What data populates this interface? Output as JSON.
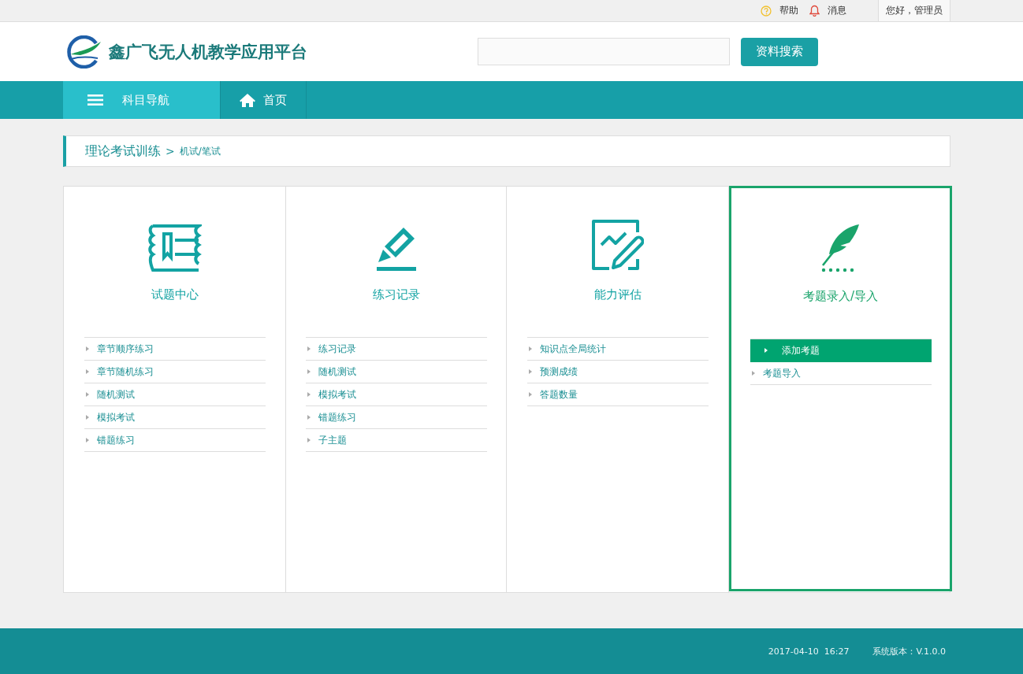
{
  "topbar": {
    "help": "帮助",
    "messages": "消息",
    "user": "您好，管理员"
  },
  "header": {
    "logo_text": "鑫广飞无人机教学应用平台",
    "search_button": "资料搜索"
  },
  "nav": [
    {
      "label": "科目导航",
      "kind": "menu",
      "selected": true
    },
    {
      "label": "首页",
      "kind": "home",
      "selected": false
    }
  ],
  "breadcrumb": {
    "section": "理论考试训练",
    "separator": ">",
    "page": "机试/笔试"
  },
  "cards": [
    {
      "title": "试题中心",
      "kind": "book",
      "selected": false,
      "items": [
        {
          "label": "章节顺序练习",
          "selected": false
        },
        {
          "label": "章节随机练习",
          "selected": false
        },
        {
          "label": "随机测试",
          "selected": false
        },
        {
          "label": "模拟考试",
          "selected": false
        },
        {
          "label": "错题练习",
          "selected": false
        }
      ]
    },
    {
      "title": "练习记录",
      "kind": "pencil",
      "selected": false,
      "items": [
        {
          "label": "练习记录",
          "selected": false
        },
        {
          "label": "随机测试",
          "selected": false
        },
        {
          "label": "模拟考试",
          "selected": false
        },
        {
          "label": "错题练习",
          "selected": false
        },
        {
          "label": "子主题",
          "selected": false
        }
      ]
    },
    {
      "title": "能力评估",
      "kind": "chart",
      "selected": false,
      "items": [
        {
          "label": "知识点全局统计",
          "selected": false
        },
        {
          "label": "预测成绩",
          "selected": false
        },
        {
          "label": "答题数量",
          "selected": false
        }
      ]
    },
    {
      "title": "考题录入/导入",
      "kind": "feather",
      "selected": true,
      "items": [
        {
          "label": "添加考题",
          "selected": true
        },
        {
          "label": "考题导入",
          "selected": false
        }
      ]
    }
  ],
  "footer": {
    "datetime": "2017-04-10  16:27",
    "version": "系统版本：V.1.0.0"
  }
}
